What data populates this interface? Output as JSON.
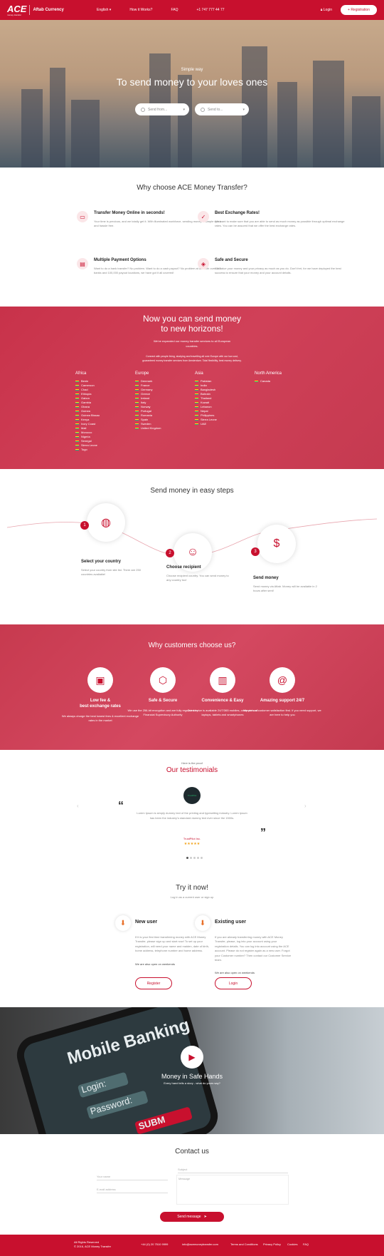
{
  "header": {
    "logo_main": "ACE",
    "logo_sub": "money transfer",
    "partner": "Aftab Currency",
    "lang": "English",
    "nav": [
      "How it Works?",
      "FAQ",
      "+1 747 777 44 77"
    ],
    "login": "Login",
    "register": "Registration"
  },
  "hero": {
    "subtitle": "Simple way",
    "title": "To send money to your loves ones",
    "send_from": "Send from...",
    "send_to": "Send to..."
  },
  "why_ace": {
    "title": "Why choose ACE Money Transfer?",
    "features": [
      {
        "title": "Transfer Money Online in seconds!",
        "icon": "computer-icon",
        "text": "Your time is precious, and we totally get it. With illuminated workforce, sending money is simple quick and hassle free."
      },
      {
        "title": "Best Exchange Rates!",
        "icon": "rates-icon",
        "text": "We want to make sure that you are able to send as much money as possible through optimal exchange rates. You can be assured that we offer the best exchange rates."
      },
      {
        "title": "Multiple Payment Options",
        "icon": "payment-icon",
        "text": "Want to do a bank transfer? No problem. Want to do a cash payout? No problem at all! With over 140 banks and 100,000 payout locations, we have got it all covered!"
      },
      {
        "title": "Safe and Secure",
        "icon": "secure-icon",
        "text": "We value your money and your privacy as much as you do. Don't fret, for we have deployed the best success to ensure that your money and your account details."
      }
    ]
  },
  "horizons": {
    "title_1": "Now you can send money",
    "title_2": "to new horizons!",
    "p1a": "We've expanded our money transfer services to all European",
    "p1b": "countries.",
    "p2a": "Connect with people living, studying and travelling all over Europe with our low cost,",
    "p2b": "guaranteed money transfer services from Amsterdam. Total flexibility, best money delivery.",
    "regions": [
      {
        "name": "Africa",
        "countries": [
          "Benin",
          "Cameroon",
          "Chad",
          "Ethiopia",
          "Gabon",
          "Gambia",
          "Ghana",
          "Guinea",
          "Guinea Bissau",
          "Kenya",
          "Ivory Coast",
          "Mali",
          "Morocco",
          "Nigeria",
          "Senegal",
          "Sierra Leone",
          "Togo"
        ]
      },
      {
        "name": "Europe",
        "countries": [
          "Denmark",
          "France",
          "Germany",
          "Greece",
          "Ireland",
          "Italy",
          "Norway",
          "Portugal",
          "Romania",
          "Spain",
          "Sweden",
          "United Kingdom"
        ]
      },
      {
        "name": "Asia",
        "countries": [
          "Pakistan",
          "India",
          "Bangladesh",
          "Bahrain",
          "Thailand",
          "Kuwait",
          "Lebanon",
          "Nepal",
          "Philippines",
          "Sierra Leone",
          "UAE"
        ]
      },
      {
        "name": "North America",
        "countries": [
          "Canada"
        ]
      }
    ]
  },
  "steps": {
    "title": "Send money in easy steps",
    "items": [
      {
        "num": "1",
        "title": "Select your country",
        "text": "Select your country from site list. There are 250 countries available!",
        "icon": "globe-icon"
      },
      {
        "num": "2",
        "title": "Choose recipient",
        "text": "Choose recipient country. You can send money to any country too!",
        "icon": "recipient-icon"
      },
      {
        "num": "3",
        "title": "Send money",
        "text": "Send money via Aftab. Money will be available in 2 hours after sent!",
        "icon": "money-icon"
      }
    ]
  },
  "why_customers": {
    "title": "Why customers choose us?",
    "items": [
      {
        "title_1": "Low fee &",
        "title_2": "best exchange rates",
        "text": "We always charge the best lowest fees & excellent exchange rates in the market",
        "icon": "fee-icon"
      },
      {
        "title_1": "Safe & Secure",
        "title_2": "",
        "text": "We use the 256-bit encryption and are fully regulated by Financial Supervisory Authority",
        "icon": "shield-icon"
      },
      {
        "title_1": "Convenience & Easy",
        "title_2": "",
        "text": "Our service is available 24/7/365 mobiles, computers all laptops, tablets and smartphones",
        "icon": "devices-icon"
      },
      {
        "title_1": "Amazing support 24/7",
        "title_2": "",
        "text": "We put our customer satisfaction first. If you need support, we are here to help you",
        "icon": "support-icon"
      }
    ]
  },
  "testimonials": {
    "pre": "Here is the proof",
    "title": "Our testimonials",
    "badge": "TrustPilot",
    "quote": "Lorem Ipsum is simply dummy text of the printing and typesetting industry. Lorem Ipsum has been the industry's standard dummy text ever since the 1500s.",
    "author": "TrustPilot Inc.",
    "stars": "★★★★★",
    "rating": 5
  },
  "try": {
    "title": "Try it now!",
    "subtitle": "Log in as a current user or sign up",
    "new_user": {
      "title": "New user",
      "text": "If it is your first time transferring money with ACE Money Transfer, please sign up and start now! To set up your registration, will need your name and maiden, date of birth, home address, telephone number and home address.",
      "note": "We are also open on weekends",
      "button": "Register"
    },
    "existing_user": {
      "title": "Existing user",
      "text": "If you are already transferring money with ACE Money Transfer, please, log into your account using your registration details. You can log into account using the ACE account. Please do not register again as a new user. Forgot your Customer number? Then contact our Customer Service team.",
      "note": "We are also open on weekends",
      "button": "Login"
    }
  },
  "mobile": {
    "screen_title": "Mobile Banking",
    "login_label": "Login:",
    "password_label": "Password:",
    "submit": "SUBM",
    "title": "Money in Safe Hands",
    "subtitle": "Every hand tells a story - what do yours say?"
  },
  "contact": {
    "title": "Contact us",
    "name_placeholder": "Your name",
    "email_placeholder": "E-mail address",
    "subject_placeholder": "Subject",
    "message_placeholder": "Message",
    "send": "Send message"
  },
  "footer": {
    "rights_1": "All Rights Reserved",
    "rights_2": "© 2016, ACE Money Transfer",
    "phone": "+44 (0) 20 7510 9999",
    "email": "info@acemoneytransfer.com",
    "links": [
      "Terms and Conditions",
      "Privacy Policy",
      "Cookies",
      "FAQ"
    ]
  },
  "colors": {
    "brand": "#c8102e",
    "accent_orange": "#e8702a"
  }
}
